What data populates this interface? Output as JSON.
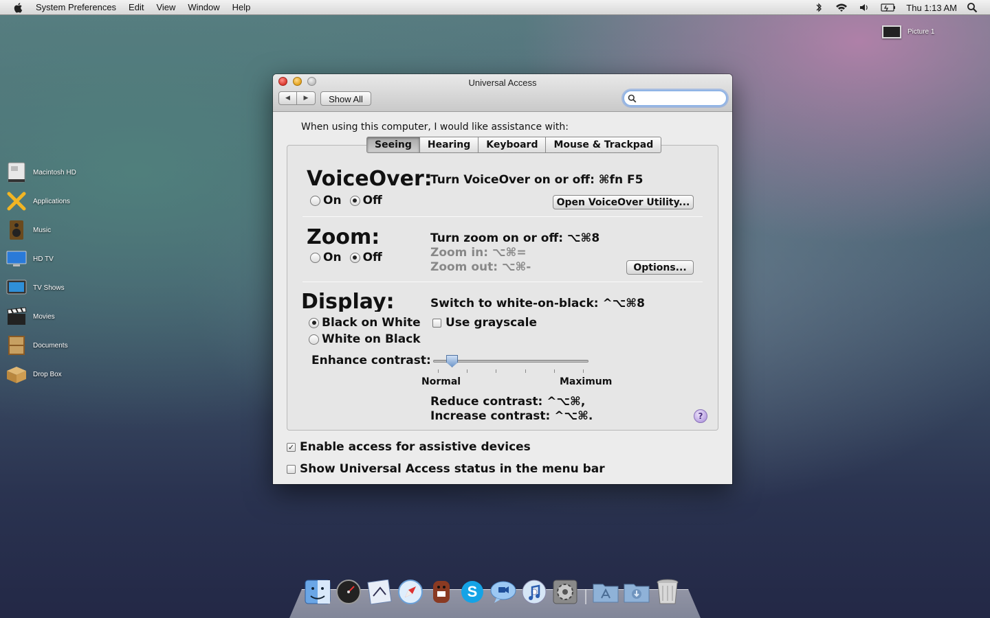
{
  "menubar": {
    "app_name": "System Preferences",
    "items": [
      "Edit",
      "View",
      "Window",
      "Help"
    ],
    "clock": "Thu 1:13 AM"
  },
  "desktop": {
    "picture_label": "Picture 1",
    "sidebar": [
      {
        "label": "Macintosh HD",
        "icon": "hard-drive-icon"
      },
      {
        "label": "Applications",
        "icon": "applications-icon"
      },
      {
        "label": "Music",
        "icon": "music-speaker-icon"
      },
      {
        "label": "HD TV",
        "icon": "tv-display-icon"
      },
      {
        "label": "TV Shows",
        "icon": "tv-shows-icon"
      },
      {
        "label": "Movies",
        "icon": "clapperboard-icon"
      },
      {
        "label": "Documents",
        "icon": "bookshelf-icon"
      },
      {
        "label": "Drop Box",
        "icon": "drop-box-icon"
      }
    ]
  },
  "window": {
    "title": "Universal Access",
    "show_all": "Show All",
    "search_placeholder": "",
    "intro": "When using this computer, I would like assistance with:",
    "tabs": [
      "Seeing",
      "Hearing",
      "Keyboard",
      "Mouse & Trackpad"
    ],
    "selected_tab": "Seeing",
    "voiceover": {
      "title": "VoiceOver:",
      "shortcut": "Turn VoiceOver on or off: ⌘fn F5",
      "on_label": "On",
      "off_label": "Off",
      "selected": "Off",
      "utility_button": "Open VoiceOver Utility..."
    },
    "zoom": {
      "title": "Zoom:",
      "shortcut": "Turn zoom on or off: ⌥⌘8",
      "zoom_in": "Zoom in: ⌥⌘=",
      "zoom_out": "Zoom out: ⌥⌘-",
      "on_label": "On",
      "off_label": "Off",
      "selected": "Off",
      "options_button": "Options..."
    },
    "display": {
      "title": "Display:",
      "shortcut": "Switch to white-on-black: ^⌥⌘8",
      "black_on_white": "Black on White",
      "white_on_black": "White on Black",
      "selected": "Black on White",
      "grayscale_label": "Use grayscale",
      "grayscale_checked": false,
      "contrast_label": "Enhance contrast:",
      "contrast_value": 0.1,
      "normal_label": "Normal",
      "maximum_label": "Maximum",
      "reduce_contrast": "Reduce contrast: ^⌥⌘,",
      "increase_contrast": "Increase contrast: ^⌥⌘."
    },
    "help_label": "?",
    "assistive_devices": "Enable access for assistive devices",
    "assistive_checked": true,
    "status_menu": "Show Universal Access status in the menu bar",
    "status_checked": false
  },
  "dock": {
    "apps": [
      "finder-icon",
      "dashboard-icon",
      "mail-icon",
      "safari-icon",
      "domo-icon",
      "skype-icon",
      "ichat-icon",
      "itunes-icon",
      "system-preferences-icon"
    ],
    "stacks": [
      "applications-folder-icon",
      "downloads-folder-icon",
      "trash-icon"
    ]
  }
}
